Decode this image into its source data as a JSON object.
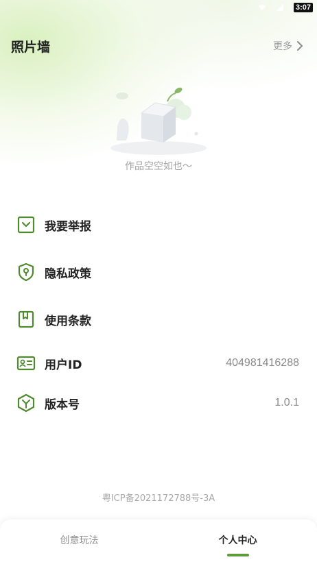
{
  "status_bar": {
    "time": "3:07",
    "icons": [
      "wifi-icon",
      "signal-icon"
    ]
  },
  "header": {
    "title": "照片墙",
    "more_label": "更多",
    "more_icon": "chevron-right-icon"
  },
  "empty_state": {
    "illustration": "empty-box-illustration",
    "text": "作品空空如也～"
  },
  "menu": [
    {
      "id": "report",
      "icon": "report-icon",
      "label": "我要举报",
      "value": ""
    },
    {
      "id": "privacy",
      "icon": "shield-icon",
      "label": "隐私政策",
      "value": ""
    },
    {
      "id": "terms",
      "icon": "book-icon",
      "label": "使用条款",
      "value": ""
    },
    {
      "id": "user-id",
      "icon": "id-card-icon",
      "label": "用户ID",
      "value": "404981416288"
    },
    {
      "id": "version",
      "icon": "version-icon",
      "label": "版本号",
      "value": "1.0.1"
    }
  ],
  "footer": {
    "icp": "粤ICP备2021172788号-3A"
  },
  "tabbar": {
    "tabs": [
      {
        "label": "创意玩法",
        "active": false
      },
      {
        "label": "个人中心",
        "active": true
      }
    ],
    "accent_color": "#5c9a3a"
  },
  "colors": {
    "accent": "#5c9a3a",
    "icon_green": "#4f8a2e"
  }
}
